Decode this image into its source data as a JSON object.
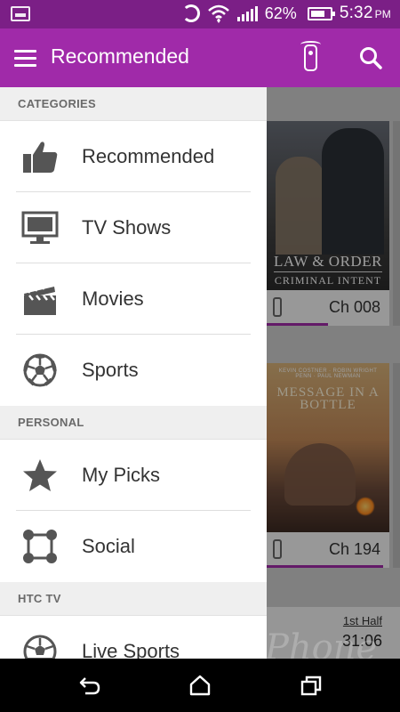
{
  "status_bar": {
    "battery_percent": "62%",
    "time": "5:32",
    "ampm": "PM",
    "icons": [
      "image-icon",
      "sync-icon",
      "wifi-icon",
      "signal-icon",
      "battery-icon"
    ]
  },
  "app_bar": {
    "title": "Recommended",
    "icons": [
      "menu-icon",
      "remote-control-icon",
      "search-icon"
    ]
  },
  "drawer": {
    "sections": [
      {
        "header": "CATEGORIES",
        "items": [
          {
            "label": "Recommended",
            "icon": "thumbs-up-icon"
          },
          {
            "label": "TV Shows",
            "icon": "tv-icon"
          },
          {
            "label": "Movies",
            "icon": "clapperboard-icon"
          },
          {
            "label": "Sports",
            "icon": "soccer-ball-icon"
          }
        ]
      },
      {
        "header": "PERSONAL",
        "items": [
          {
            "label": "My Picks",
            "icon": "star-icon"
          },
          {
            "label": "Social",
            "icon": "social-network-icon"
          }
        ]
      },
      {
        "header": "HTC TV",
        "items": [
          {
            "label": "Live Sports",
            "icon": "live-soccer-icon"
          }
        ]
      }
    ]
  },
  "content": {
    "cards": [
      {
        "poster_title": "LAW & ORDER",
        "poster_subtitle": "CRIMINAL INTENT",
        "channel": "Ch 008",
        "progress": 0.5
      },
      {
        "poster_credits": "KEVIN COSTNER · ROBIN WRIGHT PENN · PAUL NEWMAN",
        "poster_title": "MESSAGE IN A BOTTLE",
        "channel": "Ch 194",
        "progress": 0.95
      }
    ],
    "live": {
      "period": "1st Half",
      "clock": "31:06"
    }
  },
  "watermark": "Phone Scoop",
  "nav_bar": {
    "icons": [
      "back-icon",
      "home-icon",
      "recent-apps-icon"
    ]
  },
  "colors": {
    "status_bar": "#7b1f86",
    "app_bar": "#a02aa9",
    "accent": "#a02aa9"
  }
}
